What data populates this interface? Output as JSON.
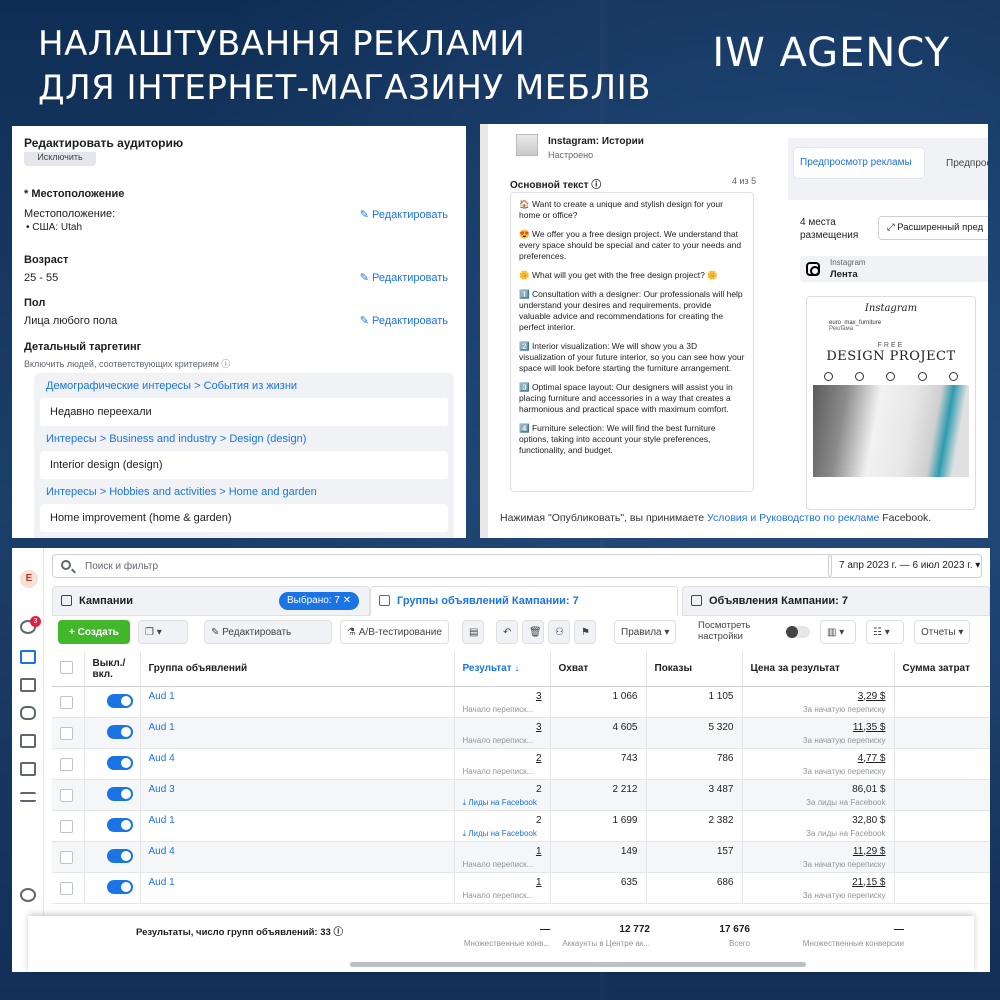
{
  "header": {
    "title_line1": "НАЛАШТУВАННЯ РЕКЛАМИ",
    "title_line2": "ДЛЯ ІНТЕРНЕТ-МАГАЗИНУ МЕБЛІВ",
    "agency": "IW AGENCY"
  },
  "audience": {
    "title": "Редактировать аудиторию",
    "exclude": "Исключить",
    "location_heading": "* Местоположение",
    "location_label": "Местоположение:",
    "location_value": "• США: Utah",
    "edit_label": "Редактировать",
    "age_heading": "Возраст",
    "age_value": "25 - 55",
    "gender_heading": "Пол",
    "gender_value": "Лица любого пола",
    "detailed_heading": "Детальный таргетинг",
    "detailed_sub": "Включить людей, соответствующих критериям",
    "groups": [
      {
        "category": "Демографические интересы > События из жизни",
        "item": "Недавно переехали"
      },
      {
        "category": "Интересы > Business and industry > Design (design)",
        "item": "Interior design (design)"
      },
      {
        "category": "Интересы > Hobbies and activities > Home and garden",
        "item": "Home improvement (home & garden)"
      }
    ]
  },
  "ad": {
    "placement_title": "Instagram: Истории",
    "placement_status": "Настроено",
    "main_text_label": "Основной текст",
    "counter": "4 из 5",
    "paragraphs": [
      "🏠 Want to create a unique and stylish design for your home or office?",
      "😍 We offer you a free design project. We understand that every space should be special and cater to your needs and preferences.",
      "🌼 What will you get with the free design project? 🌼",
      "1️⃣ Consultation with a designer: Our professionals will help understand your desires and requirements, provide valuable advice and recommendations for creating the perfect interior.",
      "2️⃣ Interior visualization: We will show you a 3D visualization of your future interior, so you can see how your space will look before starting the furniture arrangement.",
      "3️⃣ Optimal space layout: Our designers will assist you in placing furniture and accessories in a way that creates a harmonious and practical space with maximum comfort.",
      "4️⃣ Furniture selection: We will find the best furniture options, taking into account your style preferences, functionality, and budget."
    ],
    "preview_tab": "Предпросмотр рекламы",
    "preview_tab2": "Предпрос",
    "places": "4 места размещения",
    "extended": "Расширенный пред",
    "ig_label": "Instagram",
    "ig_feed": "Лента",
    "phone_logo": "Instagram",
    "phone_account": "euro_max_furniture",
    "phone_sponsored": "Реклама",
    "phone_free": "FREE",
    "phone_design": "DESIGN PROJECT",
    "footer_pre": "Нажимая \"Опубликовать\", вы принимаете ",
    "footer_link": "Условия и Руководство по рекламе",
    "footer_post": " Facebook."
  },
  "manager": {
    "avatar": "E",
    "notif_badge": "3",
    "search_placeholder": "Поиск и фильтр",
    "date_range": "7 апр 2023 г. — 6 июл 2023 г. ▾",
    "tab_campaigns": "Кампании",
    "selected_pill": "Выбрано: 7 ✕",
    "tab_adsets": "Группы объявлений Кампании: 7",
    "tab_ads": "Объявления Кампании: 7",
    "create": "+ Создать",
    "edit": "✎ Редактировать",
    "ab_test": "А/В-тестирование",
    "rules": "Правила ▾",
    "view_settings": "Посмотреть настройки",
    "reports": "Отчеты ▾",
    "columns": [
      "",
      "Выкл./вкл.",
      "Группа объявлений",
      "Результат ↓",
      "Охват",
      "Показы",
      "Цена за результат",
      "Сумма затрат"
    ],
    "rows": [
      {
        "name": "Aud 1",
        "result": "3",
        "result_sub": "Начало переписк...",
        "reach": "1 066",
        "impr": "1 105",
        "cpr": "3,29 $",
        "cpr_sub": "За начатую переписку",
        "lead": false
      },
      {
        "name": "Aud 1",
        "result": "3",
        "result_sub": "Начало переписк...",
        "reach": "4 605",
        "impr": "5 320",
        "cpr": "11,35 $",
        "cpr_sub": "За начатую переписку",
        "lead": false
      },
      {
        "name": "Aud 4",
        "result": "2",
        "result_sub": "Начало переписк...",
        "reach": "743",
        "impr": "786",
        "cpr": "4,77 $",
        "cpr_sub": "За начатую переписку",
        "lead": false
      },
      {
        "name": "Aud 3",
        "result": "2",
        "result_sub": "⤓ Лиды на Facebook",
        "reach": "2 212",
        "impr": "3 487",
        "cpr": "86,01 $",
        "cpr_sub": "За лиды на Facebook",
        "lead": true
      },
      {
        "name": "Aud 1",
        "result": "2",
        "result_sub": "⤓ Лиды на Facebook",
        "reach": "1 699",
        "impr": "2 382",
        "cpr": "32,80 $",
        "cpr_sub": "За лиды на Facebook",
        "lead": true
      },
      {
        "name": "Aud 4",
        "result": "1",
        "result_sub": "Начало переписк...",
        "reach": "149",
        "impr": "157",
        "cpr": "11,29 $",
        "cpr_sub": "За начатую переписку",
        "lead": false
      },
      {
        "name": "Aud 1",
        "result": "1",
        "result_sub": "Начало переписк...",
        "reach": "635",
        "impr": "686",
        "cpr": "21,15 $",
        "cpr_sub": "За начатую переписку",
        "lead": false
      }
    ],
    "summary": {
      "label": "Результаты, число групп объявлений: 33",
      "result": "—",
      "result_sub": "Множественные конв...",
      "reach": "12 772",
      "reach_sub": "Аккаунты в Центре ак...",
      "impr": "17 676",
      "impr_sub": "Всего",
      "cpr": "—",
      "cpr_sub": "Множественные конверсии"
    }
  }
}
